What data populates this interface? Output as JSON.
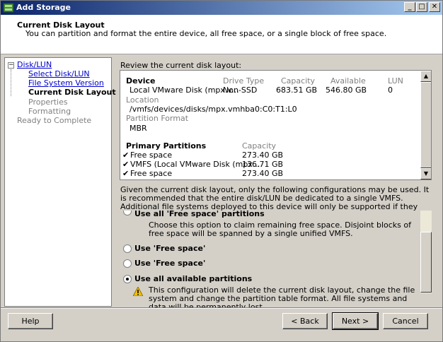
{
  "window": {
    "title": "Add Storage"
  },
  "header": {
    "title": "Current Disk Layout",
    "description": "You can partition and format the entire device, all free space, or a single block of free space."
  },
  "nav": {
    "root_label": "Disk/LUN",
    "items": [
      {
        "label": "Select Disk/LUN",
        "state": "link"
      },
      {
        "label": "File System Version",
        "state": "link"
      },
      {
        "label": "Current Disk Layout",
        "state": "current"
      },
      {
        "label": "Properties",
        "state": "disabled"
      },
      {
        "label": "Formatting",
        "state": "disabled"
      }
    ],
    "final_label": "Ready to Complete"
  },
  "layout": {
    "review_label": "Review the current disk layout:",
    "device_header": "Device",
    "drive_type_header": "Drive Type",
    "capacity_header": "Capacity",
    "available_header": "Available",
    "lun_header": "LUN",
    "device_name": "Local VMware Disk (mpx.v...",
    "drive_type": "Non-SSD",
    "capacity": "683.51 GB",
    "available": "546.80 GB",
    "lun": "0",
    "location_label": "Location",
    "location_value": "/vmfs/devices/disks/mpx.vmhba0:C0:T1:L0",
    "partition_format_label": "Partition Format",
    "partition_format_value": "MBR",
    "primary_partitions_header": "Primary Partitions",
    "partitions_capacity_header": "Capacity",
    "partitions": [
      {
        "name": "Free space",
        "capacity": "273.40 GB"
      },
      {
        "name": "VMFS (Local VMware Disk (mpx....",
        "capacity": "136.71 GB"
      },
      {
        "name": "Free space",
        "capacity": "273.40 GB"
      }
    ]
  },
  "info_text": "Given the current disk layout, only the following configurations may be used. It is recommended that the entire disk/LUN be dedicated to a single VMFS. Additional file systems deployed to this device will only be supported if they are used exclusively by the Service Console.",
  "options": [
    {
      "label": "Use all 'Free space' partitions",
      "selected": false,
      "description": "Choose this option to claim remaining free space. Disjoint blocks of free space will be spanned by a single unified VMFS."
    },
    {
      "label": "Use 'Free space'",
      "selected": false
    },
    {
      "label": "Use 'Free space'",
      "selected": false
    },
    {
      "label": "Use all available partitions",
      "selected": true,
      "description": "This configuration will delete the current disk layout, change the file system and change the partition table format. All file systems and data will be permanently lost."
    }
  ],
  "buttons": {
    "help": "Help",
    "back": "< Back",
    "next": "Next >",
    "cancel": "Cancel"
  },
  "titlebar_buttons": {
    "minimize": "_",
    "maximize": "□",
    "close": "✕"
  },
  "check_mark": "✔",
  "tree_toggle": "−",
  "scroll_glyphs": {
    "up": "▲",
    "down": "▼"
  },
  "colors": {
    "title_start": "#0a246a",
    "title_end": "#a6caf0",
    "link": "#0000cc",
    "warning": "#f0c000"
  }
}
